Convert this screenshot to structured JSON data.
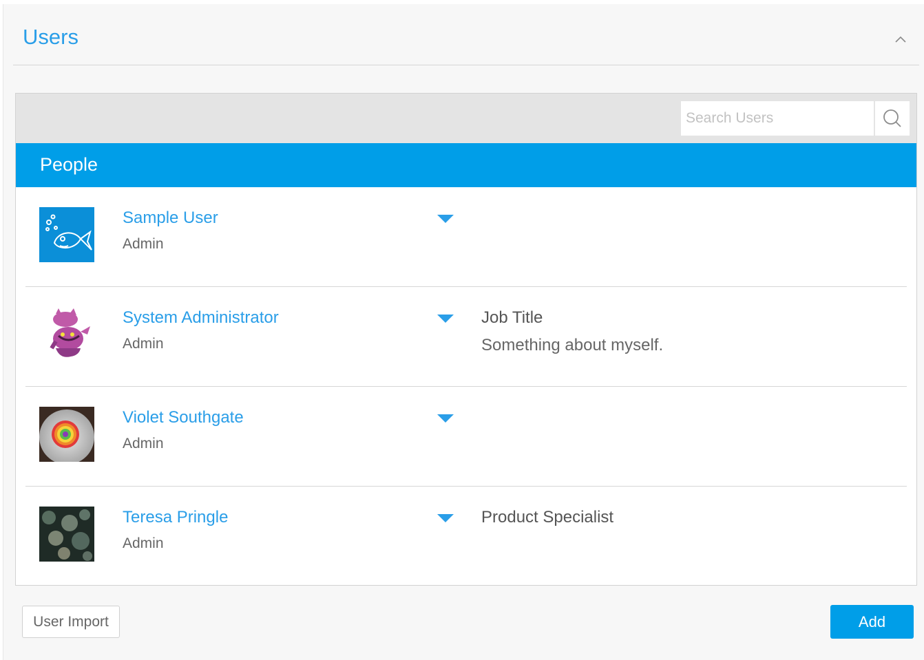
{
  "panel": {
    "title": "Users",
    "collapse_icon": "chevron-up-icon"
  },
  "search": {
    "placeholder": "Search Users",
    "value": "",
    "icon": "search-icon"
  },
  "section": {
    "title": "People"
  },
  "users": [
    {
      "name": "Sample User",
      "role": "Admin",
      "title": "",
      "about": "",
      "avatar": "fish-avatar"
    },
    {
      "name": "System Administrator",
      "role": "Admin",
      "title": "Job Title",
      "about": "Something about myself.",
      "avatar": "cat-avatar"
    },
    {
      "name": "Violet Southgate",
      "role": "Admin",
      "title": "",
      "about": "",
      "avatar": "swirl-avatar"
    },
    {
      "name": "Teresa Pringle",
      "role": "Admin",
      "title": "Product Specialist",
      "about": "",
      "avatar": "bokeh-avatar"
    }
  ],
  "footer": {
    "import_label": "User Import",
    "add_label": "Add"
  },
  "colors": {
    "accent": "#009ee8",
    "link": "#2a9ee8",
    "panel_bg": "#f7f7f7",
    "toolbar_bg": "#e4e4e4"
  }
}
